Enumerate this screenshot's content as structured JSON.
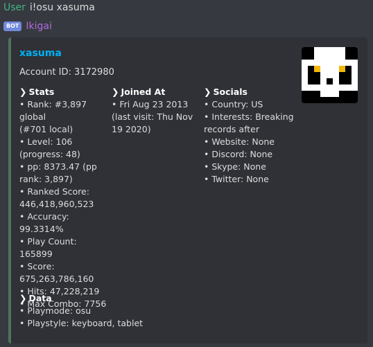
{
  "user_message": {
    "author": "User",
    "text": "i!osu xasuma"
  },
  "bot": {
    "badge": "BOT",
    "name": "Ikigai"
  },
  "embed": {
    "title": "xasuma",
    "description": "Account ID: 3172980",
    "color": "#4f745a",
    "fields": {
      "stats": {
        "name": "Stats",
        "lines": [
          "• Rank: #3,897 global",
          "(#701 local)",
          "• Level: 106",
          "(progress: 48)",
          "• pp: 8373.47 (pp",
          "rank: 3,897)",
          "• Ranked Score:",
          "446,418,960,523",
          "• Accuracy:",
          "99.3314%",
          "• Play Count: 165899",
          "• Score:",
          "675,263,786,160",
          "• Hits: 47,228,219",
          "• Max Combo: 7756"
        ]
      },
      "joined": {
        "name": "Joined At",
        "lines": [
          "• Fri Aug 23 2013",
          "(last visit: Thu Nov",
          "19 2020)"
        ]
      },
      "socials": {
        "name": "Socials",
        "lines": [
          "• Country: US",
          "• Interests: Breaking",
          "records after",
          "• Website: None",
          "• Discord: None",
          "• Skype: None",
          "• Twitter: None"
        ]
      },
      "data": {
        "name": "Data",
        "lines": [
          "• Playmode: osu",
          "• Playstyle: keyboard, tablet"
        ]
      }
    },
    "thumbnail_icon": "panda-avatar-icon"
  }
}
